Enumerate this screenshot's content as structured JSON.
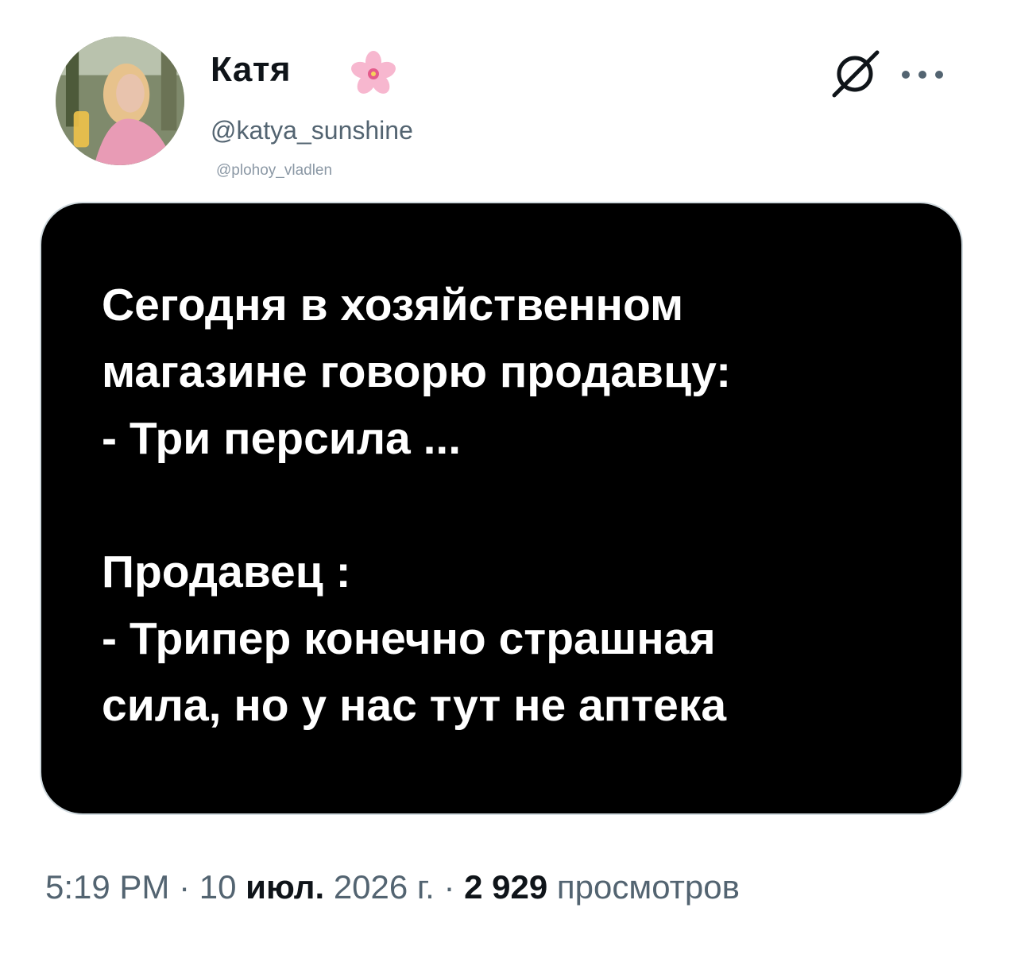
{
  "author": {
    "display_name": "Катя",
    "name_emoji_icon": "cherry-blossom-icon",
    "handle": "@katya_sunshine"
  },
  "watermark": "@plohoy_vladlen",
  "header_actions": {
    "grok_icon": "grok-slash-icon",
    "more_icon": "more-dots-icon"
  },
  "media": {
    "text": "Сегодня в хозяйственном\nмагазине говорю продавцу:\n- Три персила ...\n\nПродавец :\n- Трипер конечно страшная\nсила, но у нас тут не аптека"
  },
  "meta": {
    "time": "5:19 PM",
    "separator": " · ",
    "date_day": "10",
    "date_month": "июл.",
    "date_year": "2026 г.",
    "views_count": "2 929",
    "views_label": "просмотров"
  },
  "colors": {
    "text_primary": "#0f1419",
    "text_secondary": "#536471",
    "media_background": "#000000"
  }
}
